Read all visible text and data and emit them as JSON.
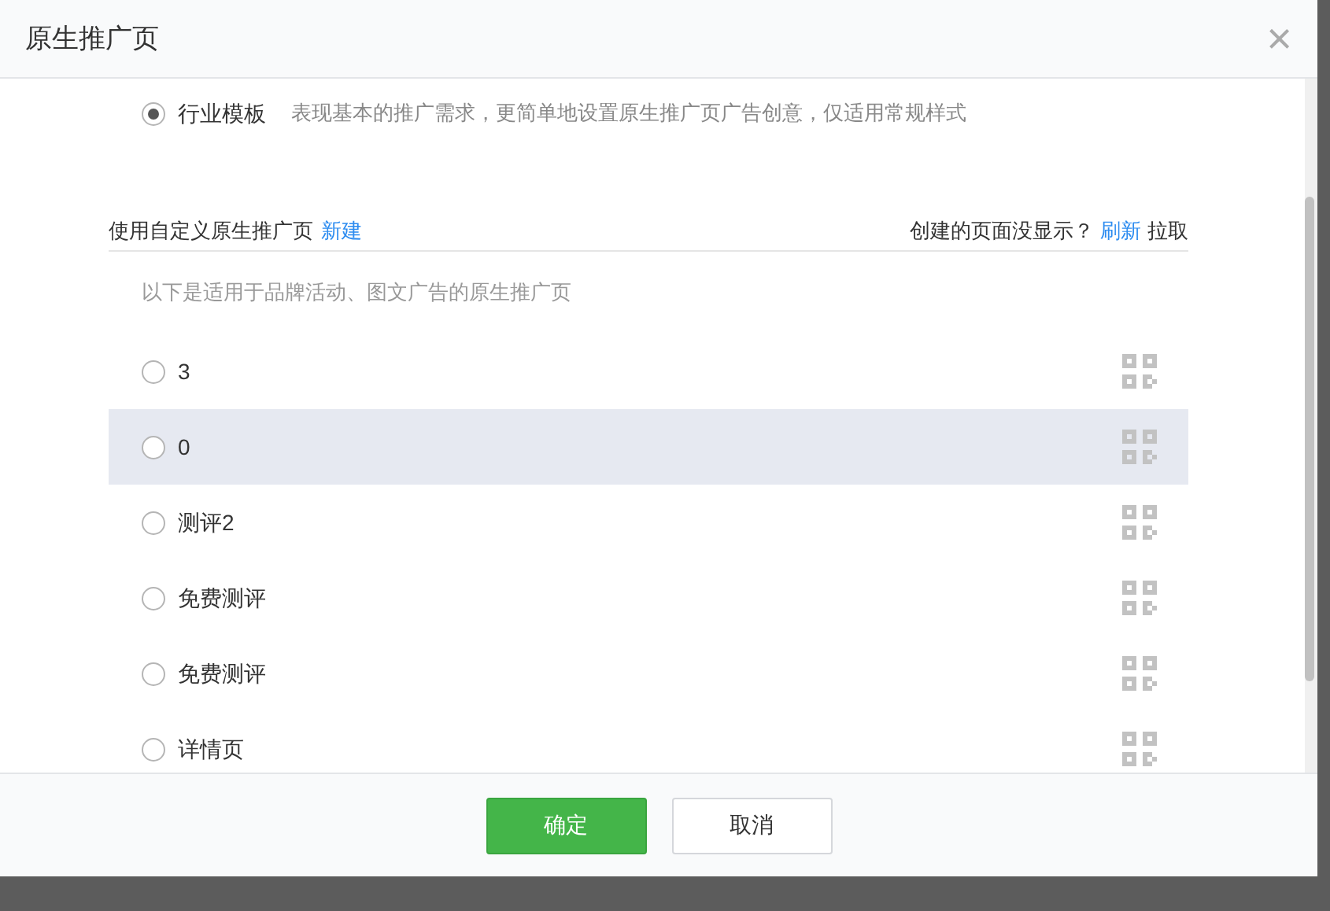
{
  "dialog": {
    "title": "原生推广页",
    "close": "×"
  },
  "template_option": {
    "label": "行业模板",
    "selected": true,
    "description": "表现基本的推广需求，更简单地设置原生推广页广告创意，仅适用常规样式"
  },
  "custom_section": {
    "title": "使用自定义原生推广页",
    "new_link": "新建",
    "hint_question": "创建的页面没显示？",
    "refresh_link": "刷新",
    "pull_link": "拉取"
  },
  "list_hint": "以下是适用于品牌活动、图文广告的原生推广页",
  "pages": [
    {
      "name": "3",
      "selected": false,
      "hovered": false
    },
    {
      "name": "0",
      "selected": false,
      "hovered": true
    },
    {
      "name": "测评2",
      "selected": false,
      "hovered": false
    },
    {
      "name": "免费测评",
      "selected": false,
      "hovered": false
    },
    {
      "name": "免费测评",
      "selected": false,
      "hovered": false
    },
    {
      "name": "详情页",
      "selected": false,
      "hovered": false
    }
  ],
  "buttons": [
    {
      "label": "确定",
      "kind": "primary"
    },
    {
      "label": "取消",
      "kind": "secondary"
    }
  ]
}
